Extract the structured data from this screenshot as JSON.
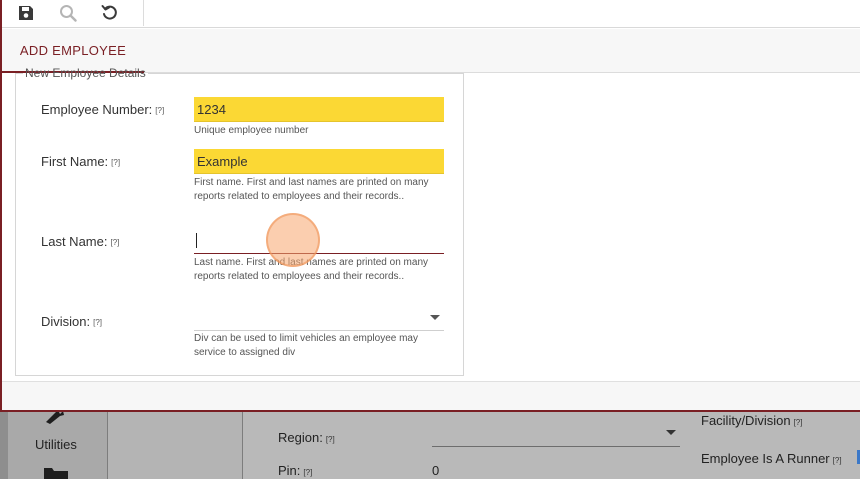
{
  "toolbar": {
    "save_icon": "save-icon",
    "search_icon": "search-icon",
    "refresh_icon": "refresh-icon"
  },
  "tabs": [
    {
      "label": "ADD EMPLOYEE",
      "active": true
    }
  ],
  "fieldset": {
    "legend": "New Employee Details"
  },
  "form": {
    "employee_number": {
      "label": "Employee Number:",
      "help": "[?]",
      "value": "1234",
      "hint": "Unique employee number"
    },
    "first_name": {
      "label": "First Name:",
      "help": "[?]",
      "value": "Example",
      "hint": "First name. First and last names are printed on many reports related to employees and their records.."
    },
    "last_name": {
      "label": "Last Name:",
      "help": "[?]",
      "value": "",
      "hint": "Last name. First and last names are printed on many reports related to employees and their records.."
    },
    "division": {
      "label": "Division:",
      "help": "[?]",
      "value": "",
      "hint": "Div can be used to limit vehicles an employee may service to assigned div"
    }
  },
  "background": {
    "sidebar_label": "Utilities",
    "region_label": "Region:",
    "pin_label": "Pin:",
    "pin_value": "0",
    "facility_label": "Facility/Division",
    "runner_label": "Employee Is A Runner",
    "help": "[?]"
  },
  "colors": {
    "accent": "#7a1f24",
    "highlight": "#fbd834"
  }
}
